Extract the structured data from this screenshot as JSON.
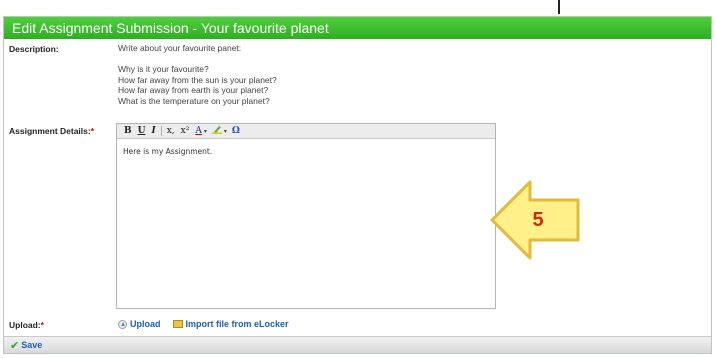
{
  "dialog": {
    "title": "Edit Assignment Submission - Your favourite planet"
  },
  "description": {
    "label": "Description:",
    "lines": [
      "Write about your favourite panet:",
      "Why is it your favourite?",
      "How far away from the sun is your planet?",
      "How far away from earth is your planet?",
      "What is the temperature on your planet?"
    ]
  },
  "assignment_details": {
    "label": "Assignment Details:",
    "required_mark": "*",
    "content": "Here is my Assignment.",
    "toolbar": {
      "bold": "B",
      "underline": "U",
      "italic": "I",
      "subscript": "x,",
      "superscript": "x²",
      "font_color": "A",
      "dropdown": "▾",
      "special_char": "Ω"
    }
  },
  "upload": {
    "label": "Upload:",
    "required_mark": "*",
    "upload_link": "Upload",
    "import_link": "Import file from eLocker"
  },
  "footer": {
    "save_label": "Save"
  },
  "callout": {
    "number": "5",
    "colors": {
      "fill": "#fff08a",
      "stroke": "#e5b93c",
      "text": "#c82e0c"
    }
  },
  "colors": {
    "title_bar": "#3cbf2e",
    "link": "#1d5fb4",
    "required": "#d00000"
  }
}
